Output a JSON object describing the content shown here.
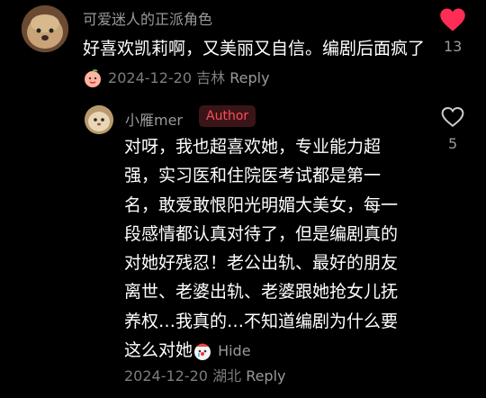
{
  "comment": {
    "username": "可爱迷人的正派角色",
    "text": "好喜欢凯莉啊，又美丽又自信。编剧后面疯了",
    "date": "2024-12-20",
    "location": "吉林",
    "reply_label": "Reply",
    "likes": "13",
    "liked": true,
    "emoji": "smiling-peach-emoji"
  },
  "reply": {
    "username": "小雁mer",
    "badge": "Author",
    "text": "对呀，我也超喜欢她，专业能力超强，实习医和住院医考试都是第一名，敢爱敢恨阳光明媚大美女，每一段感情都认真对待了，但是编剧真的对她好残忍！老公出轨、最好的朋友离世、老婆出轨、老婆跟她抢女儿抚养权…我真的…不知道编剧为什么要这么对她",
    "hide_label": "Hide",
    "date": "2024-12-20",
    "location": "湖北",
    "reply_label": "Reply",
    "likes": "5",
    "liked": false,
    "emoji": "crying-clown-emoji"
  },
  "colors": {
    "background": "#000000",
    "heart": "#ff2d55",
    "author_badge_text": "#ff4c5a",
    "author_badge_bg": "#3a1518",
    "meta": "#7d7d7d"
  }
}
